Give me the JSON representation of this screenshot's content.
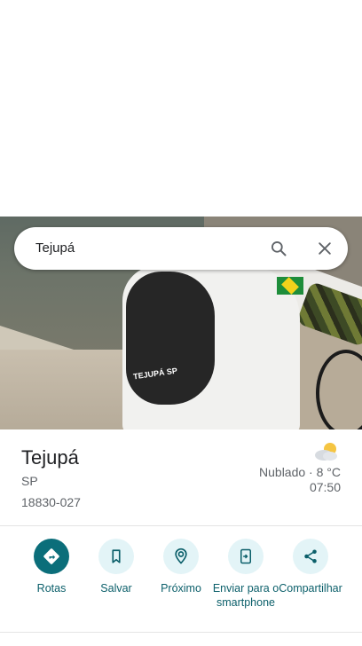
{
  "search": {
    "value": "Tejupá"
  },
  "photo": {
    "shirt_text": "TEJUPÁ SP"
  },
  "place": {
    "title": "Tejupá",
    "state": "SP",
    "cep": "18830-027"
  },
  "weather": {
    "icon": "partly-cloudy-icon",
    "condition": "Nublado · 8 °C",
    "time": "07:50"
  },
  "actions": [
    {
      "label": "Rotas",
      "icon": "directions-icon"
    },
    {
      "label": "Salvar",
      "icon": "bookmark-icon"
    },
    {
      "label": "Próximo",
      "icon": "nearby-icon"
    },
    {
      "label": "Enviar para o smartphone",
      "icon": "send-to-phone-icon"
    },
    {
      "label": "Compartilhar",
      "icon": "share-icon"
    }
  ],
  "colors": {
    "accent": "#0b6e7a",
    "accent_light": "#e3f4f7",
    "text": "#202124",
    "secondary": "#5f6368"
  }
}
